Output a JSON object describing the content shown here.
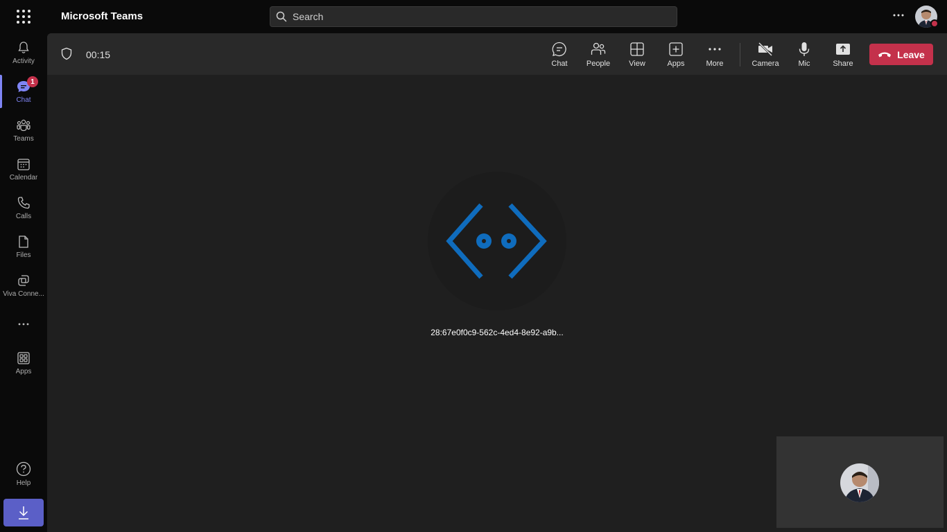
{
  "app": {
    "title": "Microsoft Teams"
  },
  "search": {
    "placeholder": "Search"
  },
  "rail": {
    "items": [
      {
        "key": "activity",
        "label": "Activity",
        "icon": "bell-icon"
      },
      {
        "key": "chat",
        "label": "Chat",
        "icon": "chat-icon",
        "badge": "1",
        "active": true
      },
      {
        "key": "teams",
        "label": "Teams",
        "icon": "teams-icon"
      },
      {
        "key": "calendar",
        "label": "Calendar",
        "icon": "calendar-icon"
      },
      {
        "key": "calls",
        "label": "Calls",
        "icon": "phone-icon"
      },
      {
        "key": "files",
        "label": "Files",
        "icon": "file-icon"
      },
      {
        "key": "viva",
        "label": "Viva Conne...",
        "icon": "viva-connections-icon"
      },
      {
        "key": "apps",
        "label": "Apps",
        "icon": "apps-icon"
      },
      {
        "key": "help",
        "label": "Help",
        "icon": "help-icon"
      }
    ]
  },
  "call": {
    "timer": "00:15",
    "controls": [
      {
        "key": "chat",
        "label": "Chat",
        "icon": "chat-bubble-icon"
      },
      {
        "key": "people",
        "label": "People",
        "icon": "people-icon"
      },
      {
        "key": "view",
        "label": "View",
        "icon": "grid-view-icon"
      },
      {
        "key": "apps",
        "label": "Apps",
        "icon": "add-app-icon"
      },
      {
        "key": "more",
        "label": "More",
        "icon": "more-horizontal-icon"
      },
      {
        "key": "camera",
        "label": "Camera",
        "icon": "camera-off-icon"
      },
      {
        "key": "mic",
        "label": "Mic",
        "icon": "microphone-icon"
      },
      {
        "key": "share",
        "label": "Share",
        "icon": "share-tray-icon"
      }
    ],
    "leave_label": "Leave",
    "participant_name": "28:67e0f0c9-562c-4ed4-8e92-a9b..."
  },
  "colors": {
    "accent": "#7f85f5",
    "leave": "#c4314b",
    "bot_logo": "#0f6cbd",
    "download": "#5b5fc7"
  }
}
